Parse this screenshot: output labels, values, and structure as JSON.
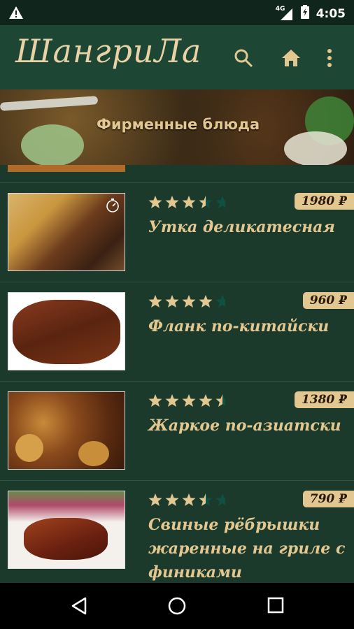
{
  "status_bar": {
    "network": "4G",
    "time": "4:05",
    "icons": [
      "warning-icon",
      "signal-icon",
      "battery-icon"
    ]
  },
  "app_bar": {
    "logo": "ШангриЛа",
    "actions": [
      "search-icon",
      "home-icon",
      "more-vert-icon"
    ]
  },
  "section": {
    "title": "Фирменные блюда"
  },
  "dishes": [
    {
      "name": "Утка деликатесная",
      "price": "1980 ₽",
      "rating": 3.5,
      "has_timer": true
    },
    {
      "name": "Фланк по-китайски",
      "price": "960 ₽",
      "rating": 4
    },
    {
      "name": "Жаркое по-азиатски",
      "price": "1380 ₽",
      "rating": 4.5
    },
    {
      "name": "Свиные рёбрышки жаренные на гриле с финиками",
      "price": "790 ₽",
      "rating": 3.5
    }
  ],
  "colors": {
    "appbar": "#1d4634",
    "background": "#1b3a2c",
    "accent_gold": "#e3c790",
    "star_filled": "#e3c790",
    "star_empty": "#0f5045"
  },
  "nav_bar": {
    "buttons": [
      "back-icon",
      "home-circle-icon",
      "recents-icon"
    ]
  }
}
